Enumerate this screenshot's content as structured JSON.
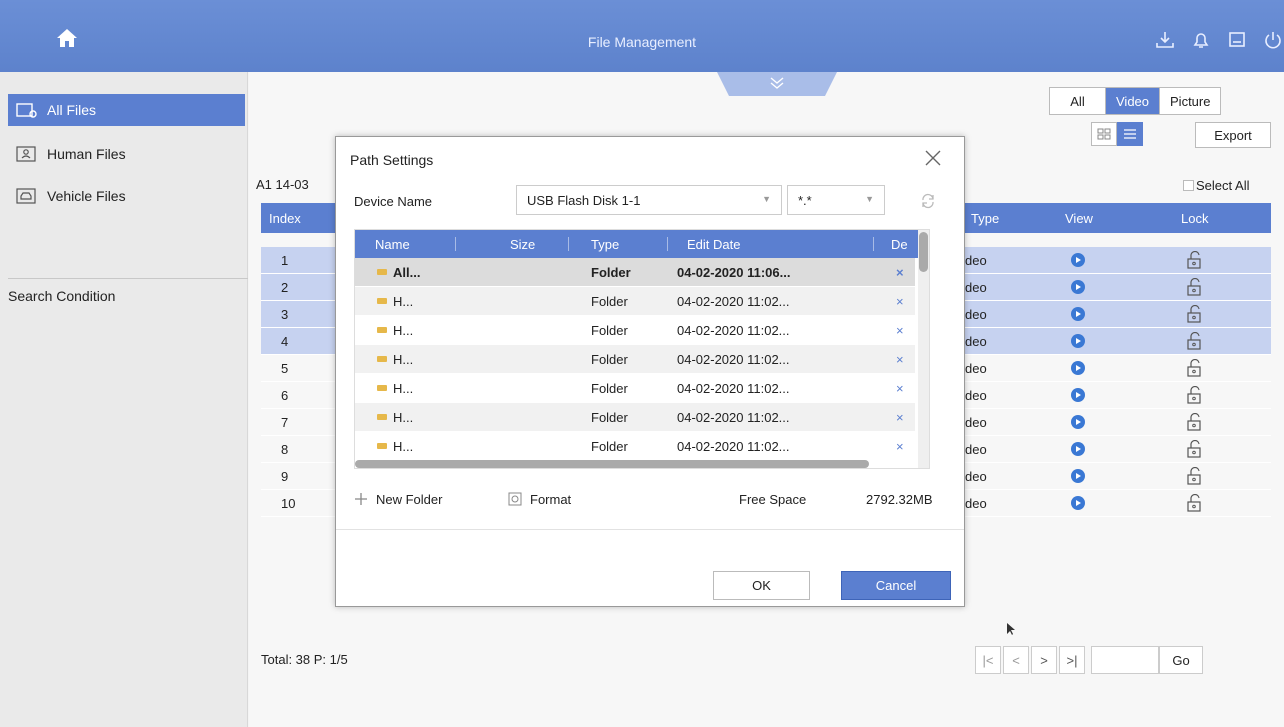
{
  "titlebar": {
    "title": "File Management",
    "icons": [
      "home-icon",
      "download-icon",
      "bell-icon",
      "device-icon",
      "power-icon"
    ],
    "color": "#6b8fd6"
  },
  "sidebar": {
    "items": [
      {
        "label": "All Files",
        "icon": "all-files-icon",
        "active": true
      },
      {
        "label": "Human Files",
        "icon": "human-icon",
        "active": false
      },
      {
        "label": "Vehicle Files",
        "icon": "vehicle-icon",
        "active": false
      }
    ],
    "search_condition": "Search Condition"
  },
  "main": {
    "filters": [
      "All",
      "Video",
      "Picture"
    ],
    "selected_filter": "Video",
    "export_label": "Export",
    "breadcrumb": "A1 14-03",
    "select_all": "Select All",
    "columns": {
      "index": "Index",
      "type": "Type",
      "view": "View",
      "lock": "Lock"
    },
    "rows": [
      {
        "index": "1",
        "type": "deo",
        "highlight": true
      },
      {
        "index": "2",
        "type": "deo",
        "highlight": true
      },
      {
        "index": "3",
        "type": "deo",
        "highlight": true
      },
      {
        "index": "4",
        "type": "deo",
        "highlight": true
      },
      {
        "index": "5",
        "type": "deo",
        "highlight": false
      },
      {
        "index": "6",
        "type": "deo",
        "highlight": false
      },
      {
        "index": "7",
        "type": "deo",
        "highlight": false
      },
      {
        "index": "8",
        "type": "deo",
        "highlight": false
      },
      {
        "index": "9",
        "type": "deo",
        "highlight": false
      },
      {
        "index": "10",
        "type": "deo",
        "highlight": false
      }
    ],
    "total": "Total: 38 P: 1/5",
    "pager": {
      "first": "|<",
      "prev": "<",
      "next": ">",
      "last": ">|",
      "go": "Go",
      "page_value": ""
    }
  },
  "dialog": {
    "title": "Path Settings",
    "device_label": "Device Name",
    "device_value": "USB Flash Disk 1-1",
    "filter_value": "*.*",
    "columns": {
      "name": "Name",
      "size": "Size",
      "type": "Type",
      "date": "Edit Date",
      "del": "De"
    },
    "files": [
      {
        "name": "All...",
        "type": "Folder",
        "date": "04-02-2020 11:06...",
        "del": "×"
      },
      {
        "name": "H...",
        "type": "Folder",
        "date": "04-02-2020 11:02...",
        "del": "×"
      },
      {
        "name": "H...",
        "type": "Folder",
        "date": "04-02-2020 11:02...",
        "del": "×"
      },
      {
        "name": "H...",
        "type": "Folder",
        "date": "04-02-2020 11:02...",
        "del": "×"
      },
      {
        "name": "H...",
        "type": "Folder",
        "date": "04-02-2020 11:02...",
        "del": "×"
      },
      {
        "name": "H...",
        "type": "Folder",
        "date": "04-02-2020 11:02...",
        "del": "×"
      },
      {
        "name": "H...",
        "type": "Folder",
        "date": "04-02-2020 11:02...",
        "del": "×"
      }
    ],
    "new_folder": "New Folder",
    "format": "Format",
    "free_space_label": "Free Space",
    "free_space_value": "2792.32MB",
    "ok": "OK",
    "cancel": "Cancel"
  }
}
